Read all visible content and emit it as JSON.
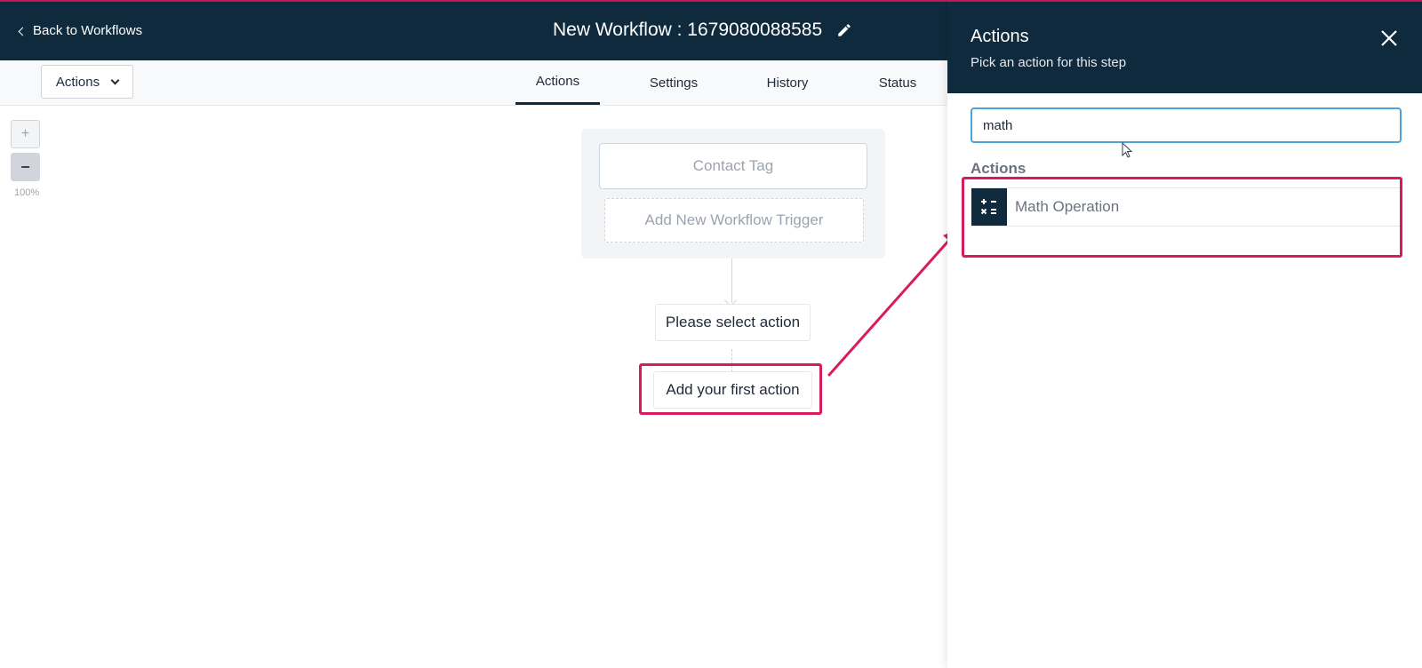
{
  "header": {
    "back_label": "Back to Workflows",
    "workflow_title": "New Workflow : 1679080088585"
  },
  "toolbar": {
    "actions_dropdown": "Actions",
    "tabs": [
      {
        "label": "Actions",
        "active": true
      },
      {
        "label": "Settings",
        "active": false
      },
      {
        "label": "History",
        "active": false
      },
      {
        "label": "Status",
        "active": false
      }
    ]
  },
  "canvas": {
    "zoom_in": "+",
    "zoom_out": "−",
    "zoom_level": "100%",
    "trigger": "Contact Tag",
    "add_trigger": "Add New Workflow Trigger",
    "select_action": "Please select action",
    "first_action": "Add your first action"
  },
  "panel": {
    "title": "Actions",
    "subtitle": "Pick an action for this step",
    "search_value": "math",
    "section_label": "Actions",
    "results": [
      {
        "label": "Math Operation",
        "icon": "calculator-icon"
      }
    ]
  },
  "colors": {
    "header_bg": "#0f2a3d",
    "highlight": "#d81b60",
    "input_focus": "#4ba3d8"
  }
}
